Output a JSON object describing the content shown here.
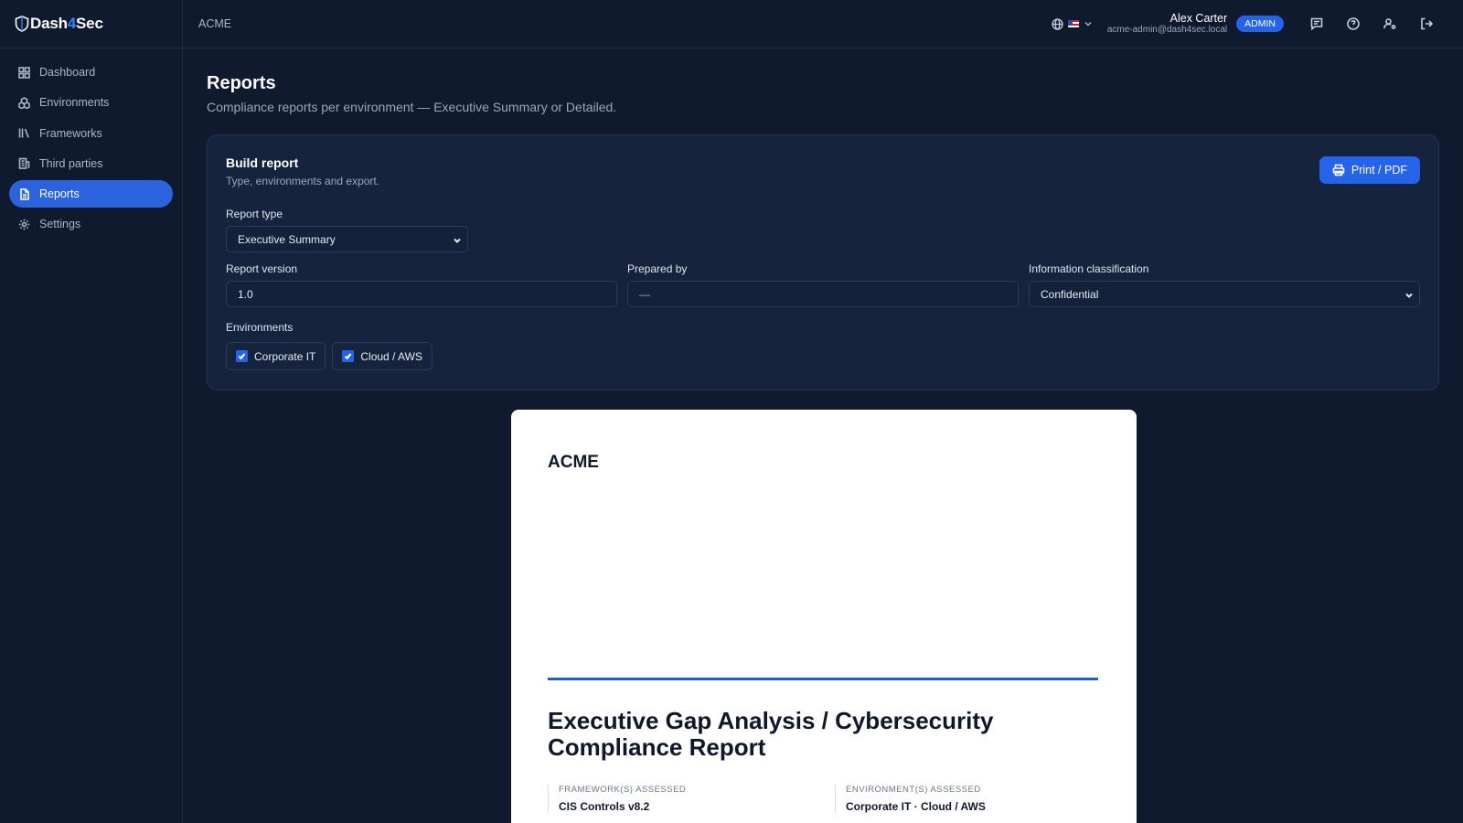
{
  "app": {
    "brand_prefix": "Dash",
    "brand_mid": "4",
    "brand_suffix": "Sec"
  },
  "sidebar": {
    "items": [
      {
        "label": "Dashboard",
        "icon": "grid-icon"
      },
      {
        "label": "Environments",
        "icon": "cubes-icon"
      },
      {
        "label": "Frameworks",
        "icon": "library-icon"
      },
      {
        "label": "Third parties",
        "icon": "building-icon"
      },
      {
        "label": "Reports",
        "icon": "file-icon",
        "active": true
      },
      {
        "label": "Settings",
        "icon": "gear-icon"
      }
    ]
  },
  "header": {
    "org": "ACME",
    "user_name": "Alex Carter",
    "user_email": "acme-admin@dash4sec.local",
    "role_badge": "ADMIN"
  },
  "page": {
    "title": "Reports",
    "subtitle": "Compliance reports per environment — Executive Summary or Detailed."
  },
  "builder": {
    "title": "Build report",
    "subtitle": "Type, environments and export.",
    "print_label": "Print / PDF",
    "report_type_label": "Report type",
    "report_type_value": "Executive Summary",
    "version_label": "Report version",
    "version_value": "1.0",
    "prepared_label": "Prepared by",
    "prepared_value": "—",
    "classification_label": "Information classification",
    "classification_value": "Confidential",
    "environments_label": "Environments",
    "environments": [
      {
        "label": "Corporate IT",
        "checked": true
      },
      {
        "label": "Cloud / AWS",
        "checked": true
      }
    ]
  },
  "preview": {
    "org": "ACME",
    "title": "Executive Gap Analysis / Cybersecurity Compliance Report",
    "frameworks_key": "FRAMEWORK(S) ASSESSED",
    "frameworks_value": "CIS Controls v8.2",
    "environments_key": "ENVIRONMENT(S) ASSESSED",
    "environments_value": "Corporate IT · Cloud / AWS"
  },
  "colors": {
    "accent": "#2563eb",
    "background": "#0f1a2e",
    "card": "#15233d"
  }
}
